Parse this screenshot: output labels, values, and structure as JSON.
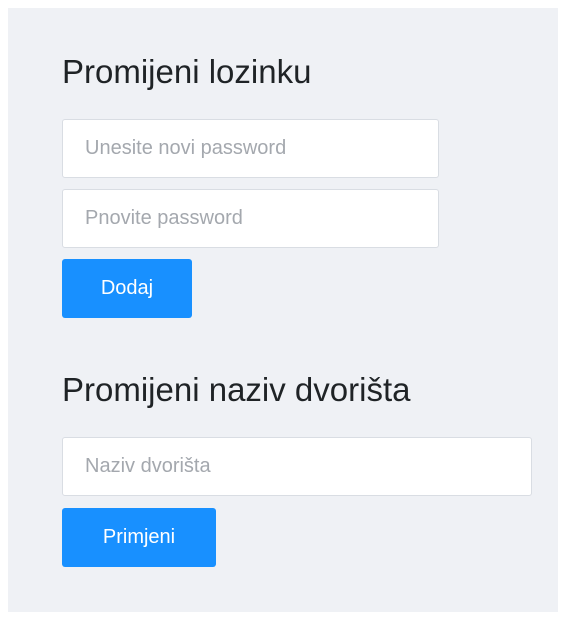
{
  "change_password": {
    "title": "Promijeni lozinku",
    "new_password": {
      "value": "",
      "placeholder": "Unesite novi password"
    },
    "repeat_password": {
      "value": "",
      "placeholder": "Pnovite password"
    },
    "submit_label": "Dodaj"
  },
  "change_yard_name": {
    "title": "Promijeni naziv dvorišta",
    "yard_name": {
      "value": "",
      "placeholder": "Naziv dvorišta"
    },
    "submit_label": "Primjeni"
  },
  "colors": {
    "panel_background": "#eff1f5",
    "primary_button": "#1890ff",
    "heading_text": "#1f2326",
    "placeholder_text": "#a4a8ae"
  }
}
